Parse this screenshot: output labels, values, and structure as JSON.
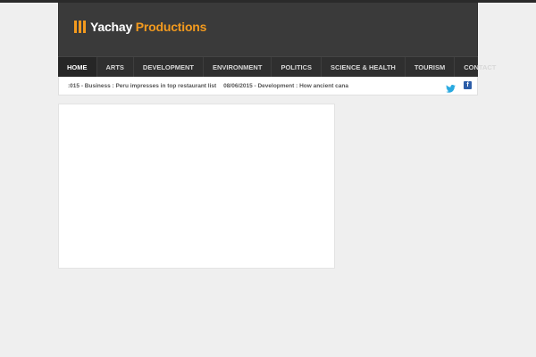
{
  "brand": {
    "name_primary": "Yachay",
    "name_accent": "Productions",
    "accent_color": "#f39a1e"
  },
  "nav": {
    "items": [
      {
        "label": "Home"
      },
      {
        "label": "Arts"
      },
      {
        "label": "Development"
      },
      {
        "label": "Environment"
      },
      {
        "label": "Politics"
      },
      {
        "label": "Science & Health"
      },
      {
        "label": "Tourism"
      },
      {
        "label": "Contact"
      }
    ]
  },
  "ticker": {
    "items": [
      {
        "text": ":015 - Business : Peru impresses in top restaurant list"
      },
      {
        "text": "08/06/2015 - Development : How ancient cana"
      }
    ]
  },
  "social": {
    "twitter_icon": "twitter-icon",
    "facebook_icon": "facebook-icon",
    "facebook_glyph": "f"
  }
}
